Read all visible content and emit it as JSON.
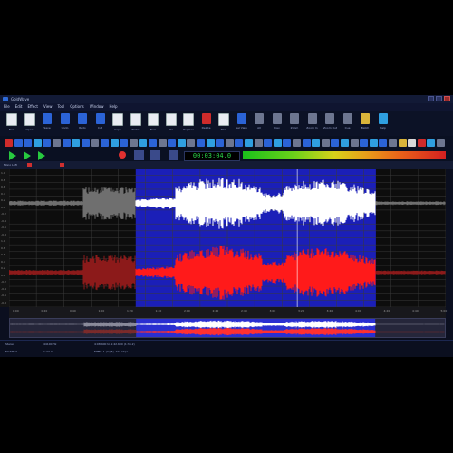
{
  "window": {
    "title": "GoldWave"
  },
  "menu": [
    "File",
    "Edit",
    "Effect",
    "View",
    "Tool",
    "Options",
    "Window",
    "Help"
  ],
  "toolbar": {
    "items": [
      {
        "label": "New",
        "icon": "new-doc-icon",
        "color": "doc"
      },
      {
        "label": "Open",
        "icon": "open-icon",
        "color": "doc"
      },
      {
        "label": "Save",
        "icon": "save-icon",
        "color": "blue"
      },
      {
        "label": "Undo",
        "icon": "undo-icon",
        "color": "blue"
      },
      {
        "label": "Redo",
        "icon": "redo-icon",
        "color": "blue"
      },
      {
        "label": "Cut",
        "icon": "cut-icon",
        "color": "blue"
      },
      {
        "label": "Copy",
        "icon": "copy-icon",
        "color": "doc"
      },
      {
        "label": "Paste",
        "icon": "paste-icon",
        "color": "doc"
      },
      {
        "label": "New",
        "icon": "paste-new-icon",
        "color": "doc"
      },
      {
        "label": "Mix",
        "icon": "mix-icon",
        "color": "doc"
      },
      {
        "label": "Replace",
        "icon": "replace-icon",
        "color": "doc"
      },
      {
        "label": "Delete",
        "icon": "delete-icon",
        "color": "red"
      },
      {
        "label": "Trim",
        "icon": "trim-icon",
        "color": "doc"
      },
      {
        "label": "Sel View",
        "icon": "select-view-icon",
        "color": "blue"
      },
      {
        "label": "All",
        "icon": "all-icon",
        "color": "gray"
      },
      {
        "label": "Prev",
        "icon": "prev-icon",
        "color": "gray"
      },
      {
        "label": "Zoom",
        "icon": "zoom-icon",
        "color": "gray"
      },
      {
        "label": "Zoom In",
        "icon": "zoom-in-icon",
        "color": "gray"
      },
      {
        "label": "Zoom Out",
        "icon": "zoom-out-icon",
        "color": "gray"
      },
      {
        "label": "Cue",
        "icon": "cue-icon",
        "color": "gray"
      },
      {
        "label": "Batch",
        "icon": "batch-icon",
        "color": "yellow"
      },
      {
        "label": "Help",
        "icon": "help-icon",
        "color": "cyan"
      }
    ]
  },
  "transport": {
    "time": "00:03:04.0"
  },
  "track_header": {
    "label": "Mono Left"
  },
  "waveform": {
    "selection": {
      "start": 0.29,
      "end": 0.84
    },
    "channels": [
      {
        "name": "left",
        "color": "#ffffff",
        "dim_color": "#6f6f6f"
      },
      {
        "name": "right",
        "color": "#ff1a1a",
        "dim_color": "#8c1a1a"
      }
    ],
    "selection_color": "#1b1fb8"
  },
  "ruler_labels": [
    "1.0",
    "0.8",
    "0.6",
    "0.4",
    "0.2",
    "0.0",
    "-0.2",
    "-0.4",
    "-0.6",
    "-0.8",
    "1.0",
    "0.8",
    "0.6",
    "0.4",
    "0.2",
    "0.0",
    "-0.2",
    "-0.4",
    "-0.6",
    "-0.8"
  ],
  "timeline_labels": [
    "0:00",
    "0:20",
    "0:40",
    "1:00",
    "1:20",
    "1:40",
    "2:00",
    "2:20",
    "2:40",
    "3:00",
    "3:20",
    "3:40",
    "4:00",
    "4:20",
    "4:40",
    "5:00"
  ],
  "status": {
    "left1": "Stereo",
    "left2": "Modified",
    "mid1": "44100 Hz",
    "mid2": "1:24.2",
    "right1": "4:08.400 to 1:42.600 (1:34.2)",
    "right2": "MPEG-1 (mp3), 192 kbps"
  }
}
